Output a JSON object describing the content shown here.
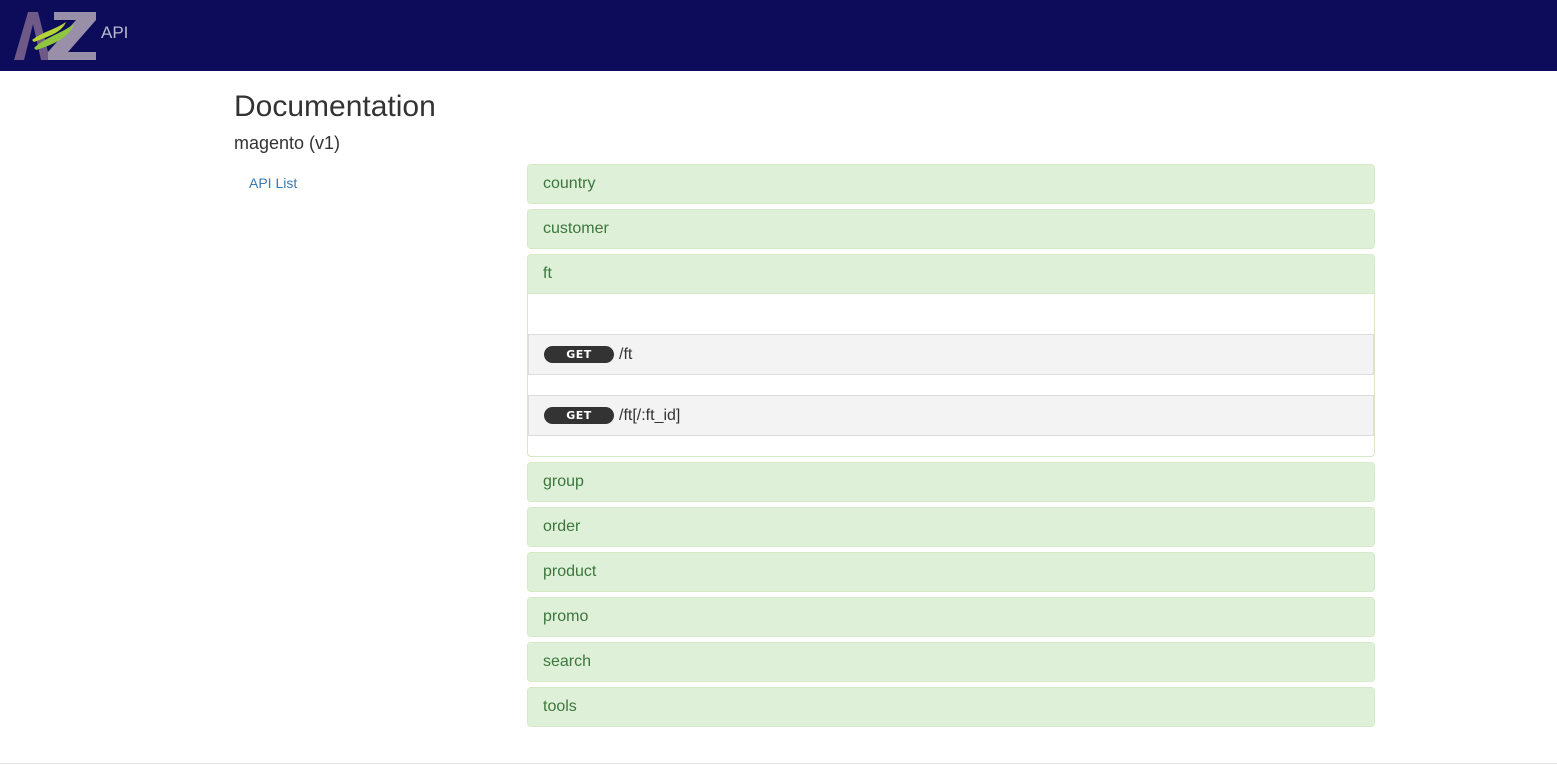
{
  "header": {
    "logo_text": "AZ",
    "logo_suffix": "API",
    "background": "#0c0c5a"
  },
  "page": {
    "title": "Documentation",
    "subtitle": "magento (v1)"
  },
  "sidebar": {
    "items": [
      {
        "label": "API List"
      }
    ]
  },
  "groups": [
    {
      "name": "country",
      "expanded": false
    },
    {
      "name": "customer",
      "expanded": false
    },
    {
      "name": "ft",
      "expanded": true,
      "endpoints": [
        {
          "method": "GET",
          "path": "/ft"
        },
        {
          "method": "GET",
          "path": "/ft[/:ft_id]"
        }
      ]
    },
    {
      "name": "group",
      "expanded": false
    },
    {
      "name": "order",
      "expanded": false
    },
    {
      "name": "product",
      "expanded": false
    },
    {
      "name": "promo",
      "expanded": false
    },
    {
      "name": "search",
      "expanded": false
    },
    {
      "name": "tools",
      "expanded": false
    }
  ],
  "colors": {
    "panel_heading_bg": "#dff0d8",
    "panel_heading_text": "#3c763d",
    "link": "#337ab7",
    "method_badge_bg": "#333333"
  }
}
